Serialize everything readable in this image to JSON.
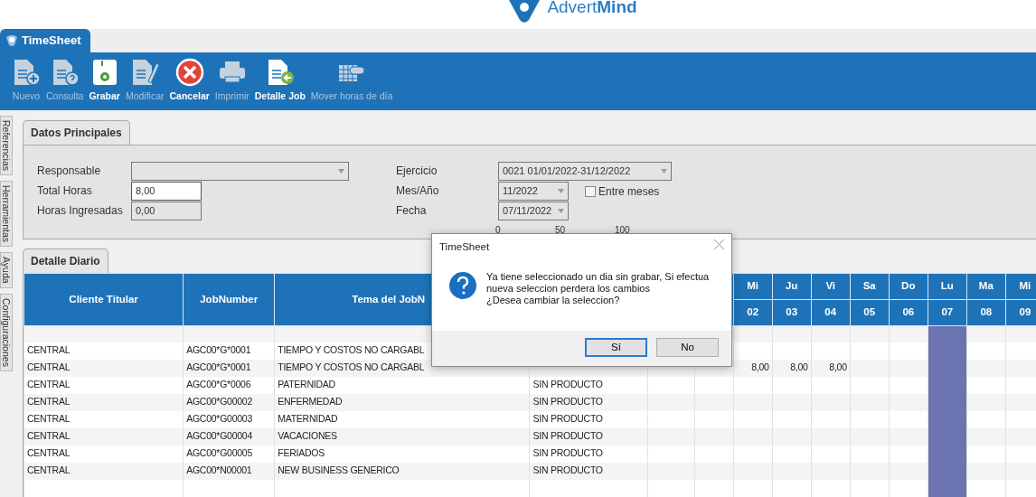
{
  "header": {
    "logo_text": "Advert**Mind**"
  },
  "app_tab": {
    "label": "TimeSheet",
    "selected": true
  },
  "toolbar": [
    {
      "label": "Nuevo",
      "disabled": true
    },
    {
      "label": "Consulta",
      "disabled": true
    },
    {
      "label": "Grabar",
      "disabled": false
    },
    {
      "label": "Modificar",
      "disabled": true
    },
    {
      "label": "Cancelar",
      "disabled": false
    },
    {
      "label": "Imprimir",
      "disabled": true
    },
    {
      "label": "Detalle Job",
      "disabled": false
    },
    {
      "label": "Mover horas de día",
      "disabled": true
    }
  ],
  "side_tabs": [
    "Referencias",
    "Herramientas",
    "Ayuda",
    "Configuraciones"
  ],
  "datos_principales": {
    "tab": "Datos Principales",
    "left_fields": [
      {
        "label": "Responsable",
        "kind": "combo",
        "readonly": true
      },
      {
        "label": "Total Horas",
        "kind": "text",
        "value": "8,00",
        "readonly": false
      },
      {
        "label": "Horas Ingresadas",
        "kind": "text",
        "value": "0,00",
        "readonly": true
      }
    ],
    "right_fields": [
      {
        "label": "Ejercicio",
        "kind": "combo",
        "value": "0021 01/01/2022-31/12/2022",
        "readonly": true
      },
      {
        "label": "Mes/Año",
        "kind": "combo",
        "value": "11/2022",
        "readonly": true,
        "checkbox": {
          "label": "Entre meses",
          "checked": false
        }
      },
      {
        "label": "Fecha",
        "kind": "combo",
        "value": "07/11/2022",
        "readonly": true
      }
    ],
    "scale_labels": [
      "0",
      "50",
      "100"
    ]
  },
  "detalle_diario": {
    "tab": "Detalle Diario",
    "columns": [
      "Cliente Titular",
      "JobNumber",
      "Tema del JobN"
    ],
    "days": [
      {
        "weekday": "Mi",
        "day": "02",
        "selected": false
      },
      {
        "weekday": "Ju",
        "day": "03",
        "selected": false
      },
      {
        "weekday": "Vi",
        "day": "04",
        "selected": false
      },
      {
        "weekday": "Sa",
        "day": "05",
        "selected": false
      },
      {
        "weekday": "Do",
        "day": "06",
        "selected": false
      },
      {
        "weekday": "Lu",
        "day": "07",
        "selected": true
      },
      {
        "weekday": "Ma",
        "day": "08",
        "selected": false
      },
      {
        "weekday": "Mi",
        "day": "09",
        "selected": false
      }
    ],
    "rows": [
      {
        "cliente_titular": "CENTRAL",
        "job_number": "AGC00*G*0001",
        "tema": "TIEMPO Y COSTOS NO CARGABL"
      },
      {
        "cliente_titular": "CENTRAL",
        "job_number": "AGC00*G*0001",
        "tema": "TIEMPO Y COSTOS NO CARGABL",
        "hours": [
          "8,00",
          "8,00",
          "8,00"
        ]
      },
      {
        "cliente_titular": "CENTRAL",
        "job_number": "AGC00*G*0006",
        "tema": "PATERNIDAD",
        "column_4": "SIN PRODUCTO"
      },
      {
        "cliente_titular": "CENTRAL",
        "job_number": "AGC00*G00002",
        "tema": "ENFERMEDAD",
        "column_4": "SIN PRODUCTO"
      },
      {
        "cliente_titular": "CENTRAL",
        "job_number": "AGC00*G00003",
        "tema": "MATERNIDAD",
        "column_4": "SIN PRODUCTO"
      },
      {
        "cliente_titular": "CENTRAL",
        "job_number": "AGC00*G00004",
        "tema": "VACACIONES",
        "column_4": "SIN PRODUCTO"
      },
      {
        "cliente_titular": "CENTRAL",
        "job_number": "AGC00*G00005",
        "tema": "FERIADOS",
        "column_4": "SIN PRODUCTO"
      },
      {
        "cliente_titular": "CENTRAL",
        "job_number": "AGC00*N00001",
        "tema": "NEW BUSINESS GENERICO",
        "column_4": "SIN PRODUCTO"
      }
    ]
  },
  "dialog": {
    "title": "TimeSheet",
    "message": [
      "Ya tiene seleccionado un dia sin grabar, Si efectua nueva seleccion perdera los cambios",
      "¿Desea cambiar la seleccion?"
    ],
    "buttons": [
      {
        "label": "Sí",
        "selected": true
      },
      {
        "label": "No",
        "selected": false
      }
    ]
  }
}
